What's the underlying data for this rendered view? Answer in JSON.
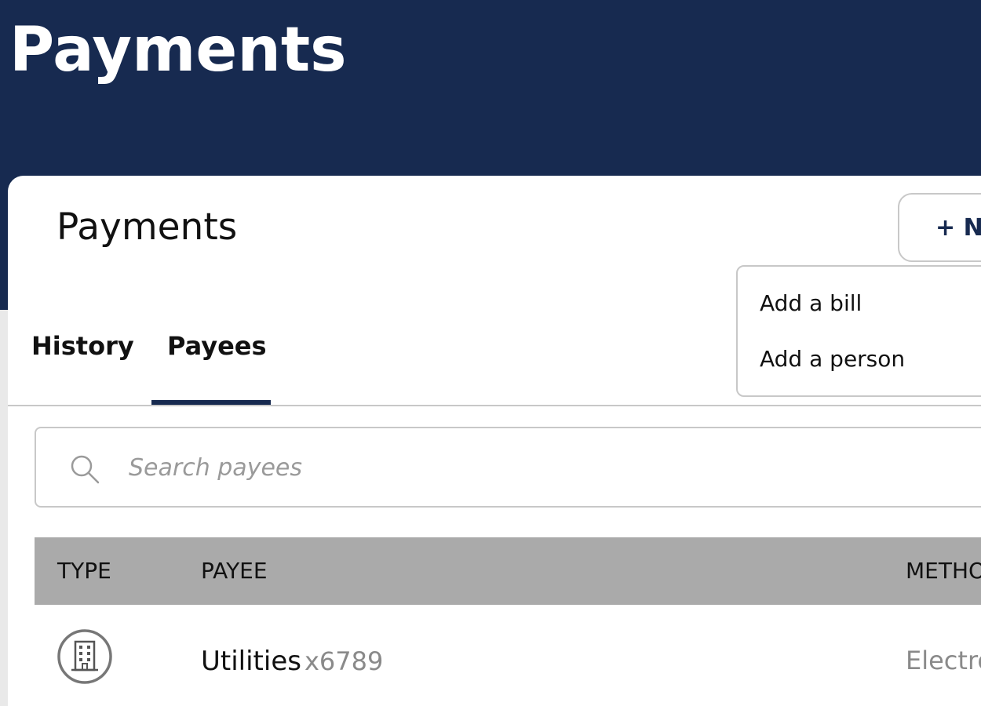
{
  "header": {
    "title": "Payments"
  },
  "card": {
    "title": "Payments",
    "new_button_label": "+ Ne",
    "menu": {
      "items": [
        {
          "label": "Add a bill"
        },
        {
          "label": "Add a person"
        }
      ]
    },
    "tabs": [
      {
        "label": "History",
        "active": false
      },
      {
        "label": "Payees",
        "active": true
      }
    ],
    "search": {
      "placeholder": "Search payees",
      "value": ""
    },
    "table": {
      "columns": [
        "TYPE",
        "PAYEE",
        "METHO"
      ],
      "rows": [
        {
          "type_icon": "building-icon",
          "payee": "Utilities",
          "account": "x6789",
          "method": "Electro"
        }
      ]
    }
  },
  "colors": {
    "navy": "#172a50",
    "header_gray": "#aaaaaa",
    "border": "#c8c8c8"
  }
}
